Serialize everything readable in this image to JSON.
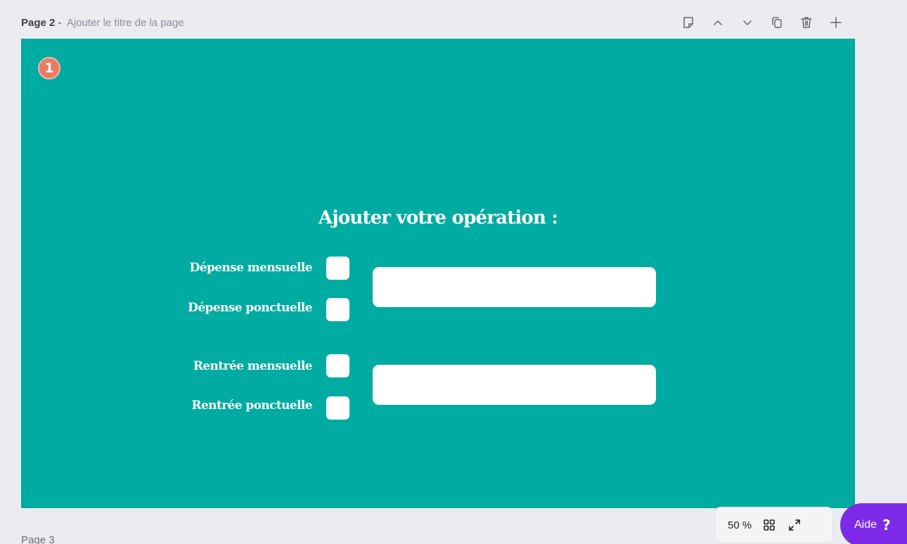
{
  "page_header": {
    "page_number": "Page 2",
    "separator": "-",
    "title_placeholder": "Ajouter le titre de la page"
  },
  "page_tools": [
    {
      "name": "notes-icon"
    },
    {
      "name": "move-up-icon"
    },
    {
      "name": "move-down-icon"
    },
    {
      "name": "duplicate-icon"
    },
    {
      "name": "delete-icon"
    },
    {
      "name": "add-page-icon"
    }
  ],
  "design": {
    "step_badge": "1",
    "title": "Ajouter votre opération :",
    "options": [
      "Dépense mensuelle",
      "Dépense ponctuelle",
      "Rentrée mensuelle",
      "Rentrée ponctuelle"
    ],
    "background_color": "#00aba2"
  },
  "next_page_label": "Page 3",
  "zoom_bar": {
    "zoom_value": "50 %",
    "grid_view_icon": "grid-icon",
    "fullscreen_icon": "expand-icon"
  },
  "help": {
    "label": "Aide",
    "icon": "?",
    "color": "#7d2ae8"
  }
}
